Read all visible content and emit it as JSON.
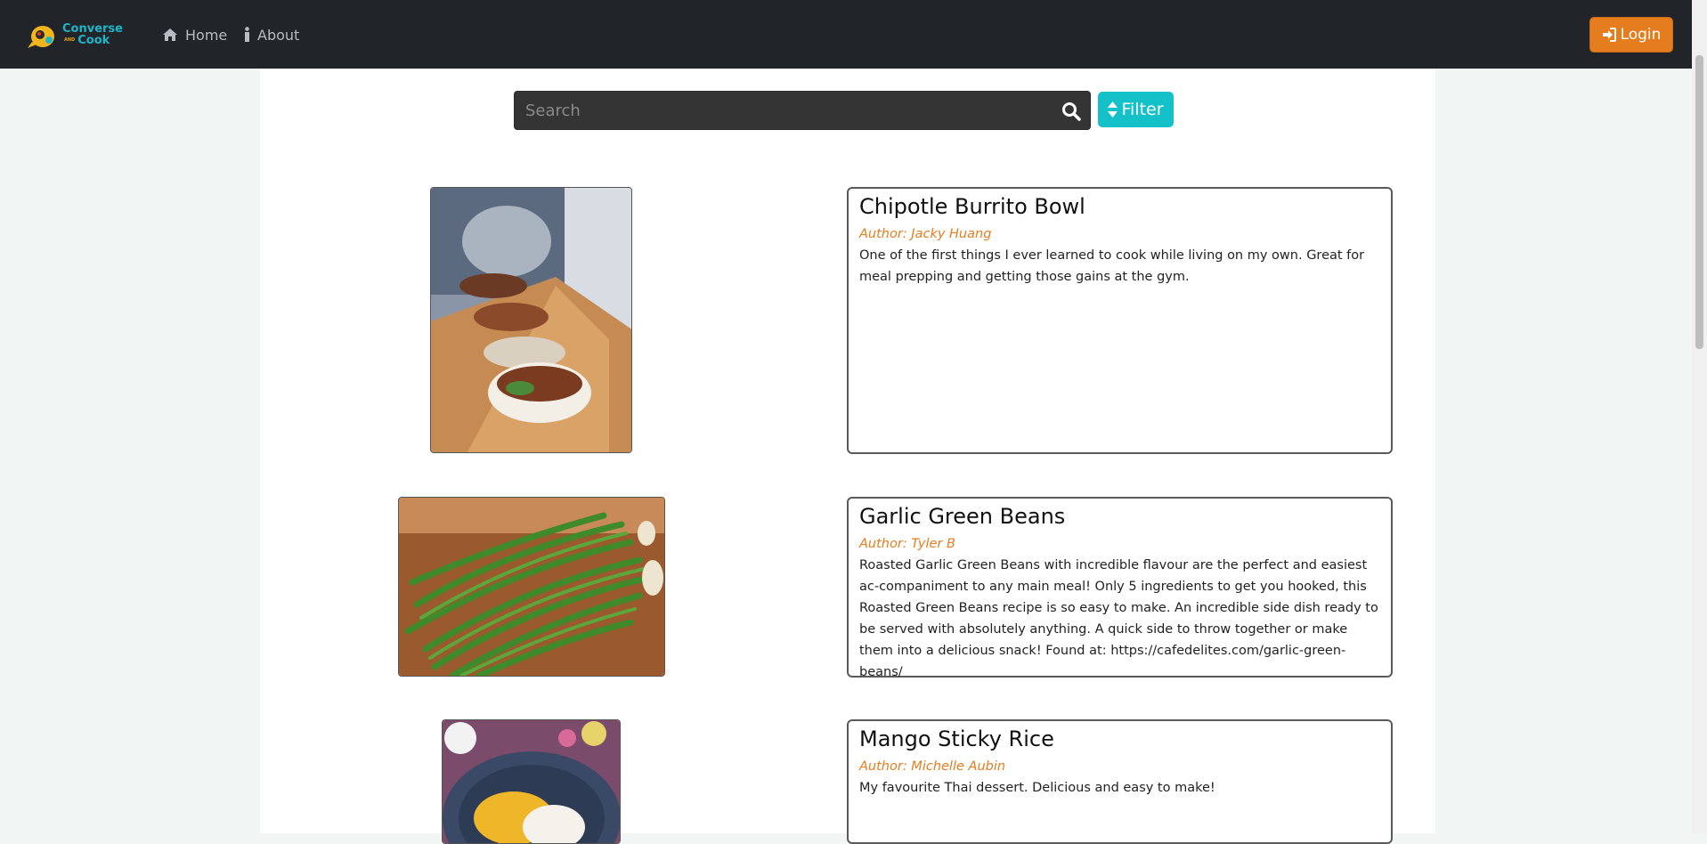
{
  "nav": {
    "logo_word1": "Converse",
    "logo_and": "AND",
    "logo_word2": "Cook",
    "home_label": "Home",
    "about_label": "About",
    "login_label": "Login"
  },
  "search": {
    "placeholder": "Search",
    "filter_label": "Filter"
  },
  "recipes": [
    {
      "title": "Chipotle Burrito Bowl",
      "author": "Author: Jacky Huang",
      "description": "One of the first things I ever learned to cook while living on my own. Great for meal prepping and getting those gains at the gym."
    },
    {
      "title": "Garlic Green Beans",
      "author": "Author: Tyler B",
      "description": "Roasted Garlic Green Beans with incredible flavour are the perfect and easiest ac-companiment to any main meal! Only 5 ingredients to get you hooked, this Roasted Green Beans recipe is so easy to make. An incredible side dish ready to be served with absolutely anything. A quick side to throw together or make them into a delicious snack! Found at: https://cafedelites.com/garlic-green-beans/"
    },
    {
      "title": "Mango Sticky Rice",
      "author": "Author: Michelle Aubin",
      "description": "My favourite Thai dessert. Delicious and easy to make!"
    }
  ],
  "colors": {
    "navbar": "#212429",
    "accent_orange": "#e57d1e",
    "filter_teal": "#14c1c9",
    "logo_teal": "#1fb5c9"
  }
}
